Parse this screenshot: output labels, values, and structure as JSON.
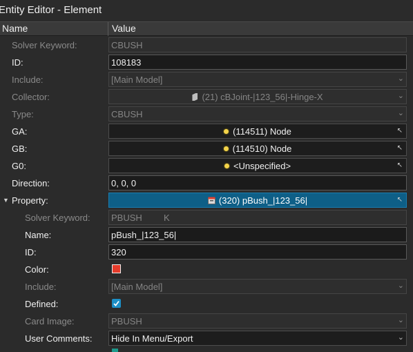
{
  "window": {
    "title": "Entity Editor - Element"
  },
  "columns": {
    "name": "Name",
    "value": "Value"
  },
  "rows": {
    "solver_keyword": {
      "label": "Solver Keyword:",
      "value": "CBUSH"
    },
    "id": {
      "label": "ID:",
      "value": "108183"
    },
    "include": {
      "label": "Include:",
      "value": "[Main Model]"
    },
    "collector": {
      "label": "Collector:",
      "value": "(21) cBJoint-|123_56|-Hinge-X"
    },
    "type": {
      "label": "Type:",
      "value": "CBUSH"
    },
    "ga": {
      "label": "GA:",
      "value": "(114511) Node"
    },
    "gb": {
      "label": "GB:",
      "value": "(114510) Node"
    },
    "g0": {
      "label": "G0:",
      "value": "<Unspecified>"
    },
    "direction": {
      "label": "Direction:",
      "value": "0, 0, 0"
    },
    "property": {
      "label": "Property:",
      "value": "(320) pBush_|123_56|"
    }
  },
  "property_rows": {
    "solver_keyword": {
      "label": "Solver Keyword:",
      "value": "PBUSH",
      "suffix": "K"
    },
    "name": {
      "label": "Name:",
      "value": "pBush_|123_56|"
    },
    "id": {
      "label": "ID:",
      "value": "320"
    },
    "color": {
      "label": "Color:",
      "swatch": "#e53b2b"
    },
    "include": {
      "label": "Include:",
      "value": "[Main Model]"
    },
    "defined": {
      "label": "Defined:",
      "checked": true
    },
    "card_image": {
      "label": "Card Image:",
      "value": "PBUSH"
    },
    "user_comments": {
      "label": "User Comments:",
      "value": "Hide In Menu/Export"
    }
  },
  "icons": {
    "node": "node-dot-icon",
    "collector": "component-icon",
    "property": "property-icon",
    "expander": "collapse-triangle-icon",
    "dropdown": "chevron-down-icon",
    "cursor": "pick-cursor-icon"
  },
  "colors": {
    "background": "#2b2b2b",
    "selected_row": "#0e5f87",
    "node_dot": "#f3d34a",
    "checkbox": "#1c8fc7"
  }
}
